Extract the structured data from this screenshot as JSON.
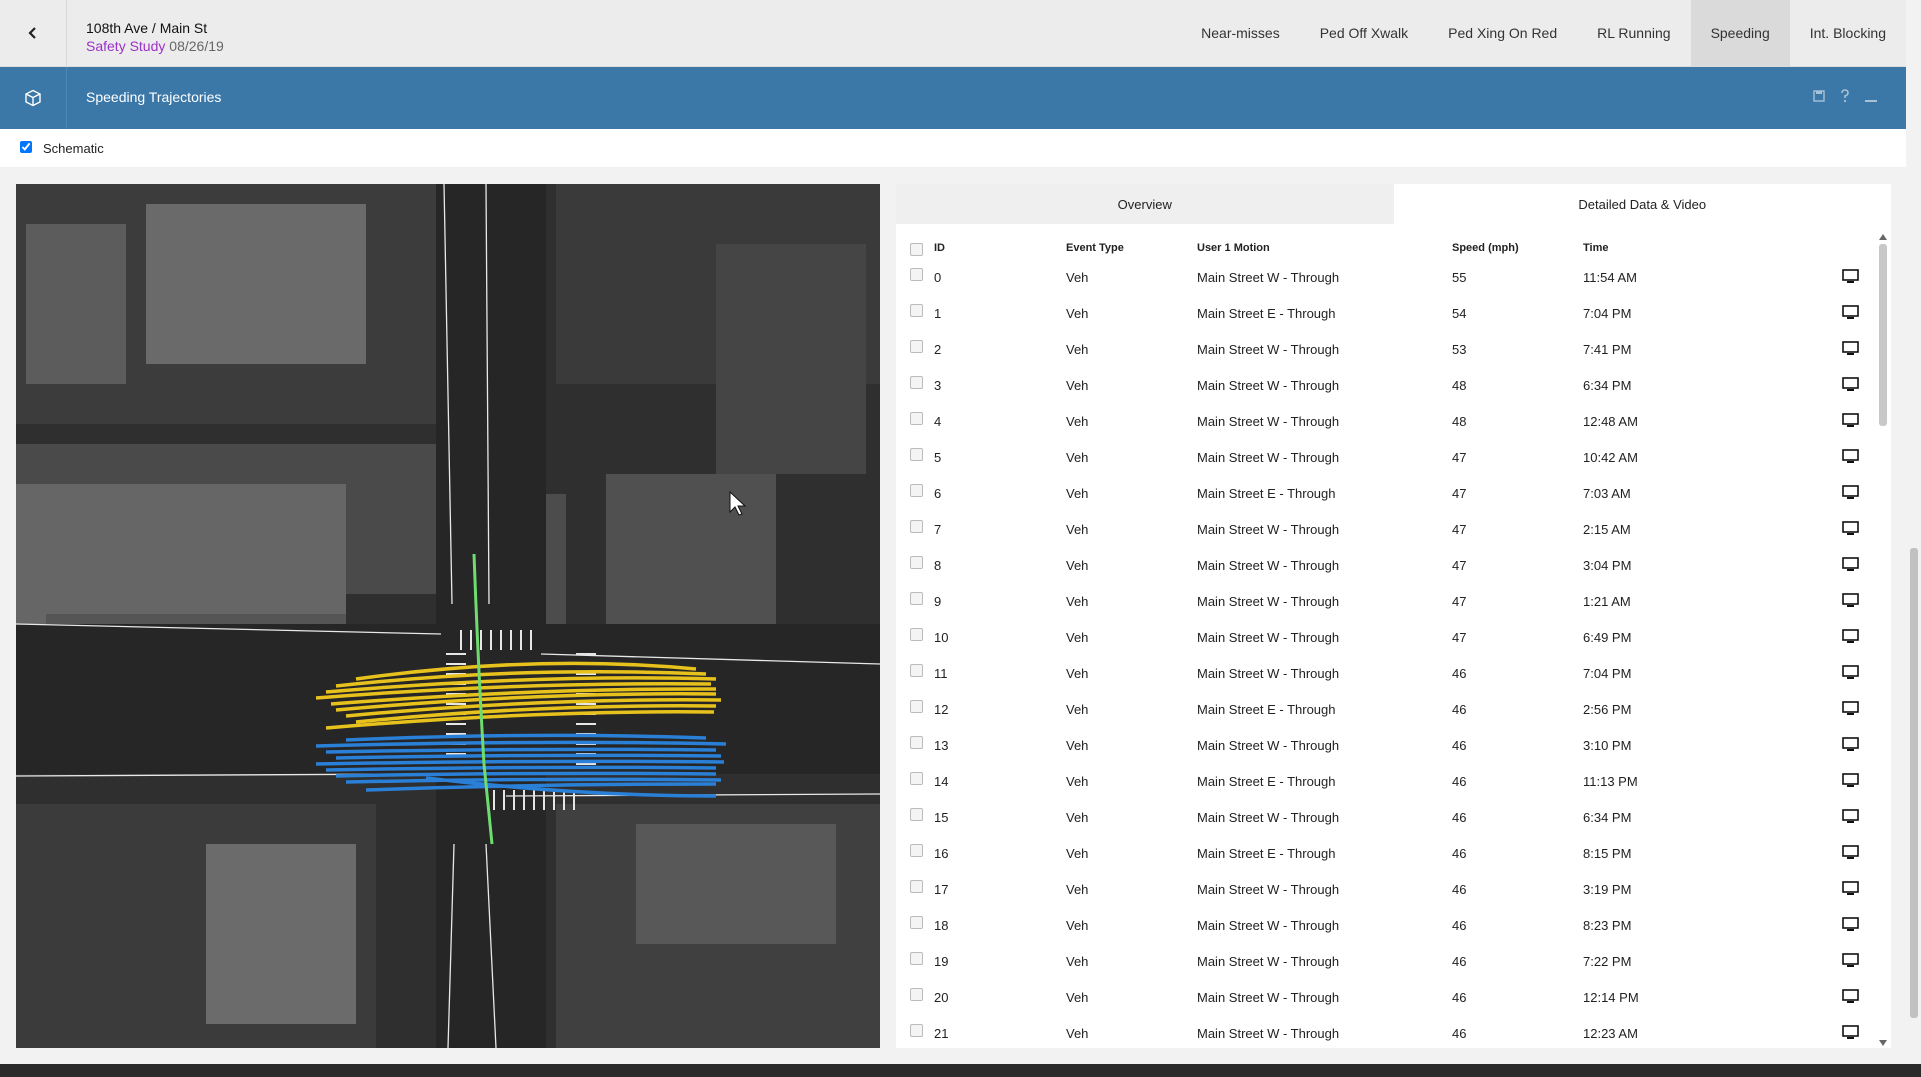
{
  "header": {
    "back_icon": "chevron-left-icon",
    "location": "108th Ave / Main St",
    "study_label": "Safety Study",
    "study_date": "08/26/19",
    "tabs": [
      "Near-misses",
      "Ped Off Xwalk",
      "Ped Xing On Red",
      "RL Running",
      "Speeding",
      "Int. Blocking"
    ],
    "active_tab": "Speeding"
  },
  "section": {
    "icon": "cube-icon",
    "title": "Speeding Trajectories",
    "tools": [
      "save-icon",
      "help-icon",
      "minimize-icon"
    ]
  },
  "schematic": {
    "label": "Schematic",
    "checked": true
  },
  "map": {
    "trajectory_colors": {
      "westbound": "#e8c21c",
      "eastbound": "#2a7fd6",
      "ped": "#6fdc6f"
    }
  },
  "panel": {
    "tabs": [
      "Overview",
      "Detailed Data & Video"
    ],
    "active_tab": "Detailed Data & Video",
    "columns": {
      "id": "ID",
      "event_type": "Event Type",
      "motion": "User 1 Motion",
      "speed": "Speed (mph)",
      "time": "Time"
    },
    "rows": [
      {
        "id": "0",
        "type": "Veh",
        "motion": "Main Street W - Through",
        "speed": "55",
        "time": "11:54 AM"
      },
      {
        "id": "1",
        "type": "Veh",
        "motion": "Main Street E - Through",
        "speed": "54",
        "time": "7:04 PM"
      },
      {
        "id": "2",
        "type": "Veh",
        "motion": "Main Street W - Through",
        "speed": "53",
        "time": "7:41 PM"
      },
      {
        "id": "3",
        "type": "Veh",
        "motion": "Main Street W - Through",
        "speed": "48",
        "time": "6:34 PM"
      },
      {
        "id": "4",
        "type": "Veh",
        "motion": "Main Street W - Through",
        "speed": "48",
        "time": "12:48 AM"
      },
      {
        "id": "5",
        "type": "Veh",
        "motion": "Main Street W - Through",
        "speed": "47",
        "time": "10:42 AM"
      },
      {
        "id": "6",
        "type": "Veh",
        "motion": "Main Street E - Through",
        "speed": "47",
        "time": "7:03 AM"
      },
      {
        "id": "7",
        "type": "Veh",
        "motion": "Main Street W - Through",
        "speed": "47",
        "time": "2:15 AM"
      },
      {
        "id": "8",
        "type": "Veh",
        "motion": "Main Street W - Through",
        "speed": "47",
        "time": "3:04 PM"
      },
      {
        "id": "9",
        "type": "Veh",
        "motion": "Main Street W - Through",
        "speed": "47",
        "time": "1:21 AM"
      },
      {
        "id": "10",
        "type": "Veh",
        "motion": "Main Street W - Through",
        "speed": "47",
        "time": "6:49 PM"
      },
      {
        "id": "11",
        "type": "Veh",
        "motion": "Main Street W - Through",
        "speed": "46",
        "time": "7:04 PM"
      },
      {
        "id": "12",
        "type": "Veh",
        "motion": "Main Street E - Through",
        "speed": "46",
        "time": "2:56 PM"
      },
      {
        "id": "13",
        "type": "Veh",
        "motion": "Main Street W - Through",
        "speed": "46",
        "time": "3:10 PM"
      },
      {
        "id": "14",
        "type": "Veh",
        "motion": "Main Street E - Through",
        "speed": "46",
        "time": "11:13 PM"
      },
      {
        "id": "15",
        "type": "Veh",
        "motion": "Main Street W - Through",
        "speed": "46",
        "time": "6:34 PM"
      },
      {
        "id": "16",
        "type": "Veh",
        "motion": "Main Street E - Through",
        "speed": "46",
        "time": "8:15 PM"
      },
      {
        "id": "17",
        "type": "Veh",
        "motion": "Main Street W - Through",
        "speed": "46",
        "time": "3:19 PM"
      },
      {
        "id": "18",
        "type": "Veh",
        "motion": "Main Street W - Through",
        "speed": "46",
        "time": "8:23 PM"
      },
      {
        "id": "19",
        "type": "Veh",
        "motion": "Main Street W - Through",
        "speed": "46",
        "time": "7:22 PM"
      },
      {
        "id": "20",
        "type": "Veh",
        "motion": "Main Street W - Through",
        "speed": "46",
        "time": "12:14 PM"
      },
      {
        "id": "21",
        "type": "Veh",
        "motion": "Main Street W - Through",
        "speed": "46",
        "time": "12:23 AM"
      }
    ]
  }
}
